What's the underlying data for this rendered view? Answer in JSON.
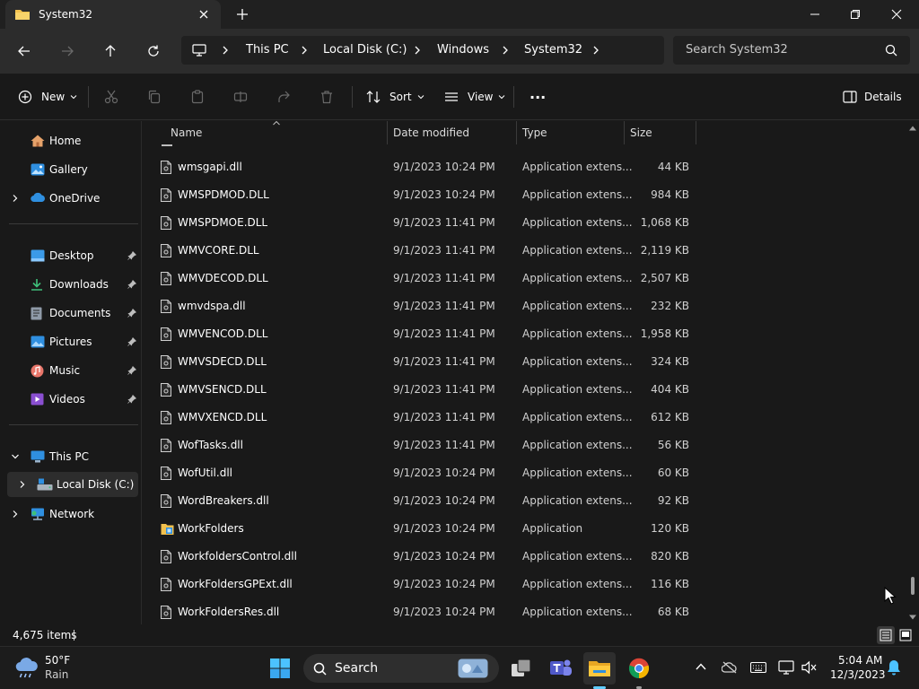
{
  "window": {
    "tab_title": "System32"
  },
  "address": {
    "breadcrumbs": [
      "This PC",
      "Local Disk (C:)",
      "Windows",
      "System32"
    ],
    "search_placeholder": "Search System32"
  },
  "toolbar": {
    "new_label": "New",
    "sort_label": "Sort",
    "view_label": "View",
    "more_label": "···",
    "details_label": "Details"
  },
  "sidebar": {
    "home": "Home",
    "gallery": "Gallery",
    "onedrive": "OneDrive",
    "quick": [
      "Desktop",
      "Downloads",
      "Documents",
      "Pictures",
      "Music",
      "Videos"
    ],
    "this_pc": "This PC",
    "local_disk": "Local Disk (C:)",
    "network": "Network"
  },
  "columns": {
    "name": "Name",
    "date": "Date modified",
    "type": "Type",
    "size": "Size"
  },
  "files": [
    {
      "name": "wmsgapi.dll",
      "date": "9/1/2023 10:24 PM",
      "type": "Application extens...",
      "size": "44 KB",
      "icon": "dll-icon"
    },
    {
      "name": "WMSPDMOD.DLL",
      "date": "9/1/2023 10:24 PM",
      "type": "Application extens...",
      "size": "984 KB",
      "icon": "dll-icon"
    },
    {
      "name": "WMSPDMOE.DLL",
      "date": "9/1/2023 11:41 PM",
      "type": "Application extens...",
      "size": "1,068 KB",
      "icon": "dll-icon"
    },
    {
      "name": "WMVCORE.DLL",
      "date": "9/1/2023 11:41 PM",
      "type": "Application extens...",
      "size": "2,119 KB",
      "icon": "dll-icon"
    },
    {
      "name": "WMVDECOD.DLL",
      "date": "9/1/2023 11:41 PM",
      "type": "Application extens...",
      "size": "2,507 KB",
      "icon": "dll-icon"
    },
    {
      "name": "wmvdspa.dll",
      "date": "9/1/2023 11:41 PM",
      "type": "Application extens...",
      "size": "232 KB",
      "icon": "dll-icon"
    },
    {
      "name": "WMVENCOD.DLL",
      "date": "9/1/2023 11:41 PM",
      "type": "Application extens...",
      "size": "1,958 KB",
      "icon": "dll-icon"
    },
    {
      "name": "WMVSDECD.DLL",
      "date": "9/1/2023 11:41 PM",
      "type": "Application extens...",
      "size": "324 KB",
      "icon": "dll-icon"
    },
    {
      "name": "WMVSENCD.DLL",
      "date": "9/1/2023 11:41 PM",
      "type": "Application extens...",
      "size": "404 KB",
      "icon": "dll-icon"
    },
    {
      "name": "WMVXENCD.DLL",
      "date": "9/1/2023 11:41 PM",
      "type": "Application extens...",
      "size": "612 KB",
      "icon": "dll-icon"
    },
    {
      "name": "WofTasks.dll",
      "date": "9/1/2023 11:41 PM",
      "type": "Application extens...",
      "size": "56 KB",
      "icon": "dll-icon"
    },
    {
      "name": "WofUtil.dll",
      "date": "9/1/2023 10:24 PM",
      "type": "Application extens...",
      "size": "60 KB",
      "icon": "dll-icon"
    },
    {
      "name": "WordBreakers.dll",
      "date": "9/1/2023 10:24 PM",
      "type": "Application extens...",
      "size": "92 KB",
      "icon": "dll-icon"
    },
    {
      "name": "WorkFolders",
      "date": "9/1/2023 10:24 PM",
      "type": "Application",
      "size": "120 KB",
      "icon": "app-icon"
    },
    {
      "name": "WorkfoldersControl.dll",
      "date": "9/1/2023 10:24 PM",
      "type": "Application extens...",
      "size": "820 KB",
      "icon": "dll-icon"
    },
    {
      "name": "WorkFoldersGPExt.dll",
      "date": "9/1/2023 10:24 PM",
      "type": "Application extens...",
      "size": "116 KB",
      "icon": "dll-icon"
    },
    {
      "name": "WorkFoldersRes.dll",
      "date": "9/1/2023 10:24 PM",
      "type": "Application extens...",
      "size": "68 KB",
      "icon": "dll-icon"
    }
  ],
  "status": {
    "item_count": "4,675 items"
  },
  "taskbar": {
    "weather_temp": "50°F",
    "weather_desc": "Rain",
    "search_label": "Search",
    "time": "5:04 AM",
    "date": "12/3/2023"
  },
  "colors": {
    "accent": "#60cdff",
    "folder": "#f2c14e",
    "background": "#191919"
  }
}
